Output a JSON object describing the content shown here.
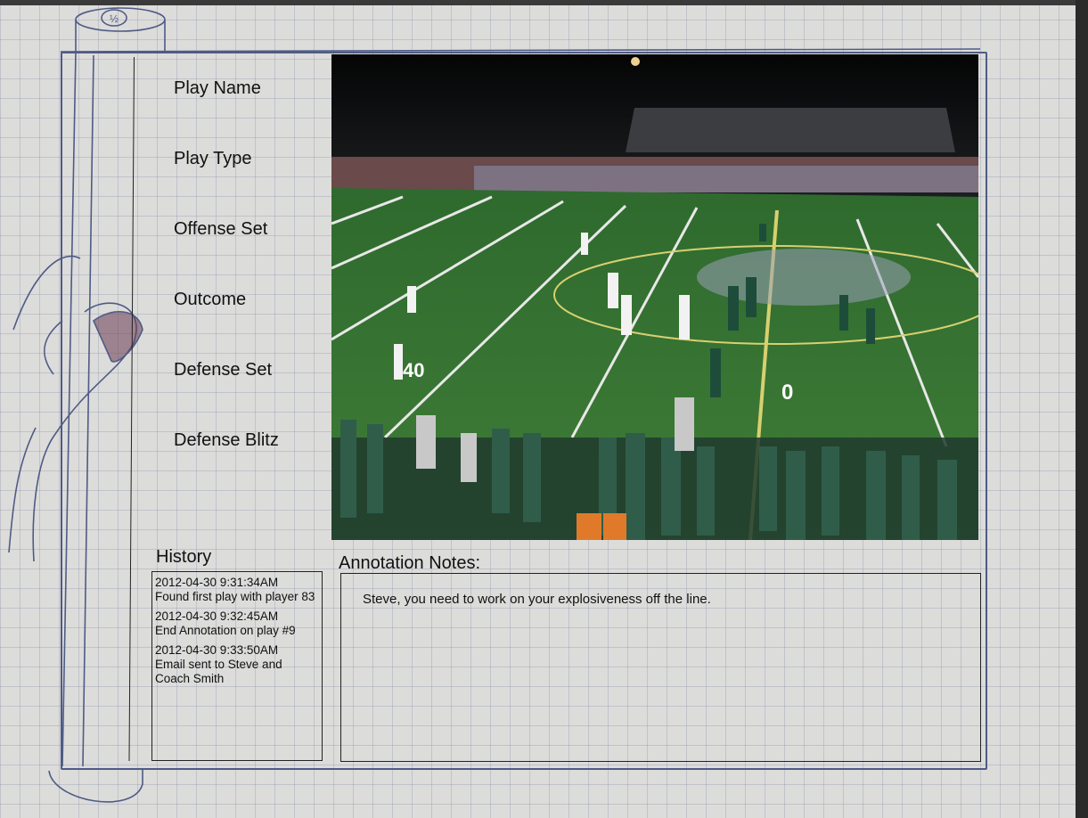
{
  "fields": [
    {
      "label": "Play Name"
    },
    {
      "label": "Play Type"
    },
    {
      "label": "Offense Set"
    },
    {
      "label": "Outcome"
    },
    {
      "label": "Defense Set"
    },
    {
      "label": "Defense Blitz"
    }
  ],
  "scroll_cap_label": "½",
  "video": {
    "yard_labels": [
      "40",
      "0"
    ],
    "description": "football-game-video-frame"
  },
  "history": {
    "title": "History",
    "entries": [
      {
        "time": "2012-04-30 9:31:34AM",
        "text": "Found first play with player 83"
      },
      {
        "time": "2012-04-30 9:32:45AM",
        "text": "End Annotation on play #9"
      },
      {
        "time": "2012-04-30 9:33:50AM",
        "text": "Email sent to Steve and Coach Smith"
      }
    ]
  },
  "notes": {
    "title": "Annotation Notes:",
    "text": "Steve, you need to work on your explosiveness off the line."
  },
  "colors": {
    "frame": "#4f5b86",
    "paper": "#dcdcda",
    "field": "#2f6a2e"
  }
}
